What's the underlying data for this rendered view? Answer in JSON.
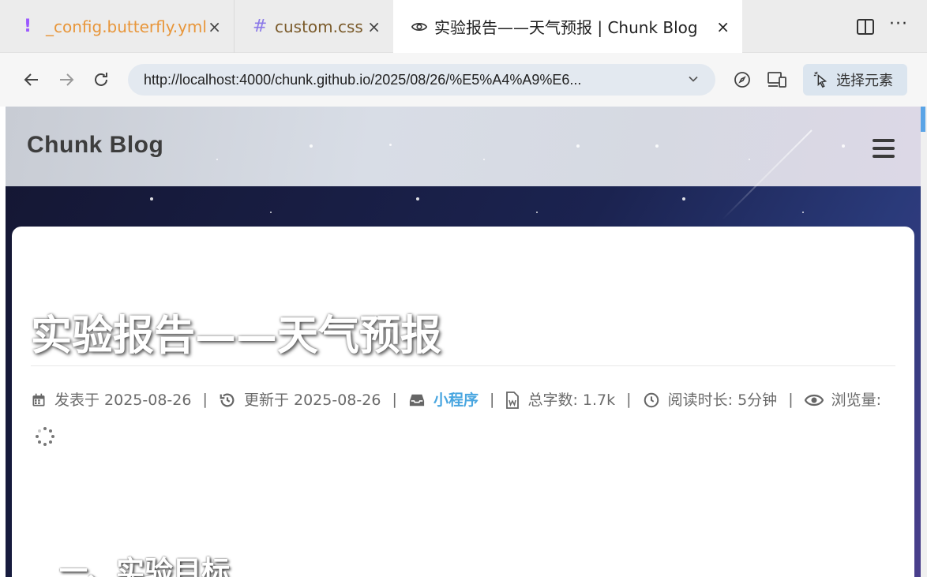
{
  "tabs": [
    {
      "icon": "!",
      "label": "_config.butterfly.yml",
      "close": "×"
    },
    {
      "icon": "#",
      "label": "custom.css",
      "close": "×"
    },
    {
      "label": "实验报告——天气预报 | Chunk Blog",
      "close": "×"
    }
  ],
  "window": {
    "more": "···"
  },
  "address": {
    "url": "http://localhost:4000/chunk.github.io/2025/08/26/%E5%A4%A9%E6...",
    "inspect_label": "选择元素"
  },
  "site": {
    "title": "Chunk Blog"
  },
  "post": {
    "title": "实验报告——天气预报",
    "meta": {
      "posted": "发表于 2025-08-26",
      "updated": "更新于 2025-08-26",
      "category": "小程序",
      "wordcount": "总字数: 1.7k",
      "readtime": "阅读时长: 5分钟",
      "views": "浏览量:",
      "separator": "|"
    },
    "section_heading": "一、实验目标"
  },
  "colors": {
    "accent_link": "#49a6e0",
    "tab_yml_text": "#e8963a",
    "tab_css_icon": "#8b79e8",
    "banner_dark": "#1b2350"
  }
}
